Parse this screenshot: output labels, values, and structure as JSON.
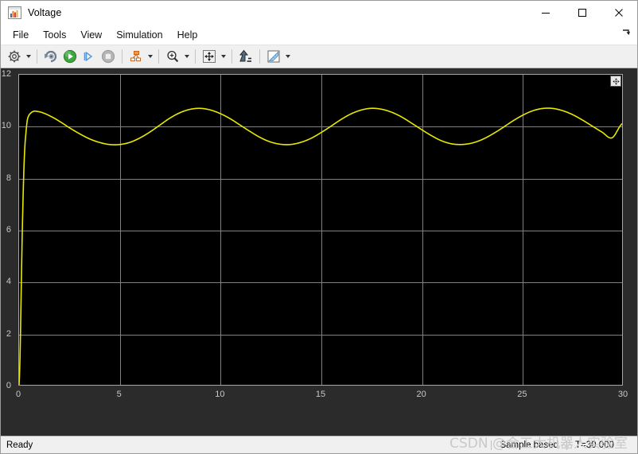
{
  "window": {
    "title": "Voltage",
    "icon": "simulink-scope-icon",
    "controls": {
      "minimize": "minimize-icon",
      "maximize": "maximize-icon",
      "close": "close-icon"
    }
  },
  "menubar": {
    "items": [
      {
        "label": "File"
      },
      {
        "label": "Tools"
      },
      {
        "label": "View"
      },
      {
        "label": "Simulation"
      },
      {
        "label": "Help"
      }
    ],
    "overflow_icon": "menu-overflow-arrow-icon"
  },
  "toolbar": {
    "buttons": [
      {
        "name": "configuration-properties",
        "icon": "gear-icon",
        "has_dropdown": true
      },
      {
        "name": "run-back-to-start",
        "icon": "rewind-icon",
        "has_dropdown": false
      },
      {
        "name": "run",
        "icon": "play-icon",
        "has_dropdown": false
      },
      {
        "name": "step-forward",
        "icon": "step-forward-icon",
        "has_dropdown": false
      },
      {
        "name": "stop",
        "icon": "stop-icon",
        "has_dropdown": false
      },
      {
        "name": "signal-selection",
        "icon": "block-diagram-icon",
        "has_dropdown": true
      },
      {
        "name": "zoom",
        "icon": "zoom-in-icon",
        "has_dropdown": true
      },
      {
        "name": "pan",
        "icon": "pan-arrows-icon",
        "has_dropdown": true
      },
      {
        "name": "autoscale",
        "icon": "autoscale-icon",
        "has_dropdown": false
      },
      {
        "name": "cursor-measurements",
        "icon": "ruler-icon",
        "has_dropdown": true
      }
    ]
  },
  "statusbar": {
    "ready_label": "Ready",
    "sample_mode": "Sample based",
    "time_label": "T=30.000"
  },
  "watermark": {
    "text": "CSDN @合工大机器人实验室"
  },
  "colors": {
    "plot_background": "#000000",
    "axes_background": "#2b2b2b",
    "grid": "#808080",
    "signal": "#e8e800",
    "tick_text": "#c8c8c8"
  },
  "chart_data": {
    "type": "line",
    "title": "",
    "xlabel": "",
    "ylabel": "",
    "xlim": [
      0,
      30
    ],
    "ylim": [
      0,
      12
    ],
    "xticks": [
      0,
      5,
      10,
      15,
      20,
      25,
      30
    ],
    "yticks": [
      0,
      2,
      4,
      6,
      8,
      10,
      12
    ],
    "grid": true,
    "legend": false,
    "series": [
      {
        "name": "Voltage",
        "color": "#e8e800",
        "points": [
          [
            0.0,
            0.0
          ],
          [
            0.05,
            1.2
          ],
          [
            0.1,
            3.4
          ],
          [
            0.15,
            5.6
          ],
          [
            0.2,
            7.3
          ],
          [
            0.25,
            8.6
          ],
          [
            0.3,
            9.4
          ],
          [
            0.4,
            10.2
          ],
          [
            0.5,
            10.45
          ],
          [
            0.7,
            10.58
          ],
          [
            0.9,
            10.58
          ],
          [
            1.2,
            10.52
          ],
          [
            1.6,
            10.38
          ],
          [
            2.0,
            10.2
          ],
          [
            2.5,
            9.95
          ],
          [
            3.0,
            9.72
          ],
          [
            3.5,
            9.52
          ],
          [
            4.0,
            9.38
          ],
          [
            4.5,
            9.3
          ],
          [
            5.0,
            9.3
          ],
          [
            5.5,
            9.38
          ],
          [
            6.0,
            9.55
          ],
          [
            6.5,
            9.78
          ],
          [
            7.0,
            10.05
          ],
          [
            7.5,
            10.32
          ],
          [
            8.0,
            10.53
          ],
          [
            8.5,
            10.66
          ],
          [
            9.0,
            10.7
          ],
          [
            9.5,
            10.64
          ],
          [
            10.0,
            10.5
          ],
          [
            10.5,
            10.3
          ],
          [
            11.0,
            10.05
          ],
          [
            11.5,
            9.8
          ],
          [
            12.0,
            9.57
          ],
          [
            12.5,
            9.4
          ],
          [
            13.0,
            9.31
          ],
          [
            13.5,
            9.3
          ],
          [
            14.0,
            9.38
          ],
          [
            14.5,
            9.53
          ],
          [
            15.0,
            9.75
          ],
          [
            15.5,
            10.0
          ],
          [
            16.0,
            10.26
          ],
          [
            16.5,
            10.48
          ],
          [
            17.0,
            10.63
          ],
          [
            17.5,
            10.7
          ],
          [
            18.0,
            10.67
          ],
          [
            18.5,
            10.56
          ],
          [
            19.0,
            10.38
          ],
          [
            19.5,
            10.14
          ],
          [
            20.0,
            9.89
          ],
          [
            20.5,
            9.65
          ],
          [
            21.0,
            9.45
          ],
          [
            21.5,
            9.33
          ],
          [
            22.0,
            9.3
          ],
          [
            22.5,
            9.35
          ],
          [
            23.0,
            9.48
          ],
          [
            23.5,
            9.68
          ],
          [
            24.0,
            9.92
          ],
          [
            24.5,
            10.18
          ],
          [
            25.0,
            10.41
          ],
          [
            25.5,
            10.59
          ],
          [
            26.0,
            10.69
          ],
          [
            26.5,
            10.7
          ],
          [
            27.0,
            10.62
          ],
          [
            27.5,
            10.47
          ],
          [
            28.0,
            10.26
          ],
          [
            28.5,
            10.02
          ],
          [
            29.0,
            9.78
          ],
          [
            29.5,
            9.56
          ],
          [
            30.0,
            10.1
          ]
        ]
      }
    ]
  }
}
